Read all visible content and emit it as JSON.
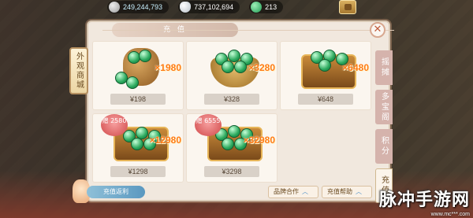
{
  "topbar": {
    "resources": [
      {
        "icon": "silver-coin-icon",
        "value": "249,244,793"
      },
      {
        "icon": "silver-ingot-icon",
        "value": "737,102,694"
      },
      {
        "icon": "jade-icon",
        "value": "213"
      }
    ]
  },
  "panel": {
    "title": "充 值",
    "left_tab": "外观商城",
    "right_tabs": [
      {
        "label": "摇摊",
        "active": false
      },
      {
        "label": "多宝阁",
        "active": false
      },
      {
        "label": "积分",
        "active": false
      },
      {
        "label": "充值",
        "active": true
      }
    ]
  },
  "products": [
    {
      "art": "jade-bag",
      "bonus": "×1980",
      "price": "¥198",
      "tag": ""
    },
    {
      "art": "jade-bowl",
      "bonus": "×3280",
      "price": "¥328",
      "tag": ""
    },
    {
      "art": "jade-chest",
      "bonus": "×6480",
      "price": "¥648",
      "tag": ""
    },
    {
      "art": "jade-chest-large",
      "bonus": "×12980",
      "price": "¥1298",
      "tag": "赠 2580"
    },
    {
      "art": "jade-chest-gold",
      "bonus": "×32980",
      "price": "¥3298",
      "tag": "赠 6555"
    }
  ],
  "bottom": {
    "left_label": "充值返利",
    "hint": "",
    "buttons": [
      {
        "label": "品牌合作"
      },
      {
        "label": "充值帮助"
      }
    ]
  },
  "watermark": {
    "text": "脉冲手游网",
    "url": "www.mc***.com"
  },
  "colors": {
    "accent_orange": "#ff7a12",
    "panel_bg": "#f1e8de",
    "jade_green": "#2aa85c"
  }
}
